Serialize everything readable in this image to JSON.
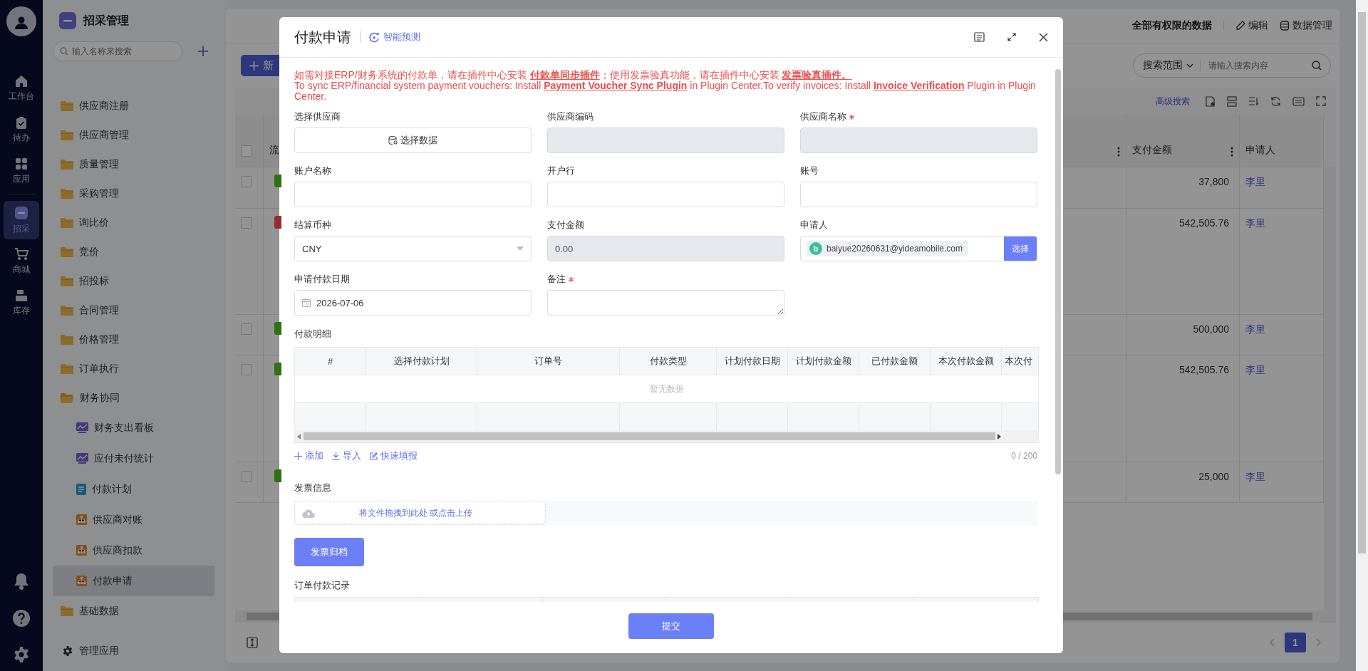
{
  "nav_rail": {
    "items": [
      {
        "label": "工作台",
        "selected": false
      },
      {
        "label": "待办",
        "selected": false
      },
      {
        "label": "应用",
        "selected": false
      },
      {
        "label": "招采",
        "selected": true
      },
      {
        "label": "商城",
        "selected": false
      },
      {
        "label": "库存",
        "selected": false
      }
    ]
  },
  "sidebar": {
    "title": "招采管理",
    "search": {
      "placeholder": "输入名称来搜索"
    },
    "items": [
      {
        "label": "供应商注册",
        "kind": "folder",
        "expanded": false,
        "selected": false
      },
      {
        "label": "供应商管理",
        "kind": "folder",
        "expanded": false,
        "selected": false
      },
      {
        "label": "质量管理",
        "kind": "folder",
        "expanded": false,
        "selected": false
      },
      {
        "label": "采购管理",
        "kind": "folder",
        "expanded": false,
        "selected": false
      },
      {
        "label": "询比价",
        "kind": "folder",
        "expanded": false,
        "selected": false
      },
      {
        "label": "竞价",
        "kind": "folder",
        "expanded": false,
        "selected": false
      },
      {
        "label": "招投标",
        "kind": "folder",
        "expanded": false,
        "selected": false
      },
      {
        "label": "合同管理",
        "kind": "folder",
        "expanded": false,
        "selected": false
      },
      {
        "label": "价格管理",
        "kind": "folder",
        "expanded": false,
        "selected": false
      },
      {
        "label": "订单执行",
        "kind": "folder",
        "expanded": false,
        "selected": false
      },
      {
        "label": "财务协同",
        "kind": "folder",
        "expanded": true,
        "selected": false,
        "children": [
          {
            "label": "财务支出看板",
            "kind": "chart",
            "selected": false
          },
          {
            "label": "应付未付统计",
            "kind": "chart",
            "selected": false
          },
          {
            "label": "付款计划",
            "kind": "doc",
            "selected": false
          },
          {
            "label": "供应商对账",
            "kind": "org",
            "selected": false
          },
          {
            "label": "供应商扣款",
            "kind": "org",
            "selected": false
          },
          {
            "label": "付款申请",
            "kind": "org",
            "selected": true
          }
        ]
      },
      {
        "label": "基础数据",
        "kind": "folder",
        "expanded": false,
        "selected": false
      }
    ],
    "footer": "管理应用"
  },
  "page": {
    "scope": "全部有权限的数据",
    "actions": [
      {
        "kind": "edit",
        "label": "编辑"
      },
      {
        "kind": "data",
        "label": "数据管理"
      }
    ],
    "new_button": "新",
    "search": {
      "scope": "搜索范围",
      "placeholder": "请输入搜索内容"
    },
    "advanced_search": "高级搜索",
    "table": {
      "columns": [
        "流",
        "支付金额",
        "申请人"
      ],
      "all_checked": false,
      "rows": [
        {
          "checked": false,
          "color": "#30720f",
          "amount": "37,800",
          "applicant": "李里"
        },
        {
          "checked": false,
          "color": "#942d2e",
          "amount": "542,505.76",
          "applicant": "李里"
        },
        {
          "checked": false,
          "color": "#30720f",
          "amount": "500,000",
          "applicant": "李里"
        },
        {
          "checked": false,
          "color": "#30720f",
          "amount": "542,505.76",
          "applicant": "李里"
        },
        {
          "checked": false,
          "color": "#30720f",
          "amount": "25,000",
          "applicant": "李里"
        }
      ]
    },
    "pagination": [
      {
        "label": "1",
        "selected": true
      }
    ]
  },
  "modal": {
    "title": "付款申请",
    "assist": "智能预测",
    "notice": [
      [
        {
          "kind": "text",
          "text": "如需对接ERP/财务系统的付款单，请在插件中心安装 "
        },
        {
          "kind": "link",
          "text": "付款单同步插件"
        },
        {
          "kind": "text",
          "text": "；使用发票验真功能，请在插件中心安装 "
        },
        {
          "kind": "link",
          "text": "发票验真插件。"
        }
      ],
      [
        {
          "kind": "text",
          "text": "To sync ERP/financial system payment vouchers: Install "
        },
        {
          "kind": "link",
          "text": "Payment Voucher Sync Plugin"
        },
        {
          "kind": "text",
          "text": " in Plugin Center.To verify invoices: Install "
        },
        {
          "kind": "link",
          "text": "Invoice Verification"
        },
        {
          "kind": "text",
          "text": " Plugin in Plugin Center."
        }
      ]
    ],
    "fields": [
      {
        "label": "选择供应商",
        "kind": "picker",
        "required": false,
        "disabled": false,
        "value": "选择数据"
      },
      {
        "label": "供应商编码",
        "kind": "input",
        "required": false,
        "disabled": true
      },
      {
        "label": "供应商名称",
        "kind": "input",
        "required": true,
        "disabled": true
      },
      {
        "label": "账户名称",
        "kind": "input",
        "required": false,
        "disabled": false
      },
      {
        "label": "开户行",
        "kind": "input",
        "required": false,
        "disabled": false
      },
      {
        "label": "账号",
        "kind": "input",
        "required": false,
        "disabled": false
      },
      {
        "label": "结算币种",
        "kind": "select",
        "required": false,
        "disabled": false,
        "value": "CNY"
      },
      {
        "label": "支付金额",
        "kind": "input",
        "required": false,
        "disabled": true,
        "value": "0.00"
      },
      {
        "label": "申请人",
        "kind": "user",
        "required": false,
        "disabled": false,
        "avatar": "b",
        "value": "baiyue20260631@yideamobile.com",
        "button": "选择"
      },
      {
        "label": "申请付款日期",
        "kind": "date",
        "required": false,
        "disabled": false,
        "value": "2026-07-06"
      },
      {
        "label": "备注",
        "kind": "textarea",
        "required": true,
        "disabled": false
      }
    ],
    "detail": {
      "label": "付款明细",
      "columns": [
        "#",
        "选择付款计划",
        "订单号",
        "付款类型",
        "计划付款日期",
        "计划付款金额",
        "已付款金额",
        "本次付款金额",
        "本次付"
      ],
      "empty_text": "暂无数据",
      "actions": [
        {
          "kind": "add",
          "label": "添加"
        },
        {
          "kind": "import",
          "label": "导入"
        },
        {
          "kind": "fill",
          "label": "快速填报"
        }
      ],
      "count": "0 / 200"
    },
    "invoice": {
      "label": "发票信息",
      "upload_text": "将文件拖拽到此处 或点击上传",
      "archive_button": "发票归档"
    },
    "records": {
      "label": "订单付款记录"
    },
    "submit": "提交"
  }
}
